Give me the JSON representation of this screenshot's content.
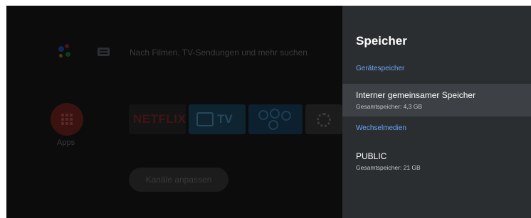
{
  "home": {
    "search_hint": "Nach Filmen, TV-Sendungen und mehr suchen",
    "apps_label": "Apps",
    "tiles": {
      "netflix": "NETFLIX",
      "tv": "TV"
    },
    "customize_channels": "Kanäle anpassen"
  },
  "panel": {
    "title": "Speicher",
    "sections": [
      {
        "label": "Gerätespeicher",
        "items": [
          {
            "title": "Interner gemeinsamer Speicher",
            "subtitle": "Gesamtspeicher: 4,3 GB",
            "focused": true
          }
        ]
      },
      {
        "label": "Wechselmedien",
        "items": [
          {
            "title": "PUBLIC",
            "subtitle": "Gesamtspeicher: 21 GB",
            "focused": false
          }
        ]
      }
    ]
  },
  "icons": [
    "google-assistant-icon",
    "keyboard-icon",
    "apps-grid-icon",
    "tv-icon",
    "games-icon",
    "settings-gear-icon"
  ],
  "colors": {
    "panel_bg": "#2b2e31",
    "focused_item_bg": "#3d4044",
    "section_label": "#6aa4f5",
    "home_bg": "#0c0c0c"
  }
}
